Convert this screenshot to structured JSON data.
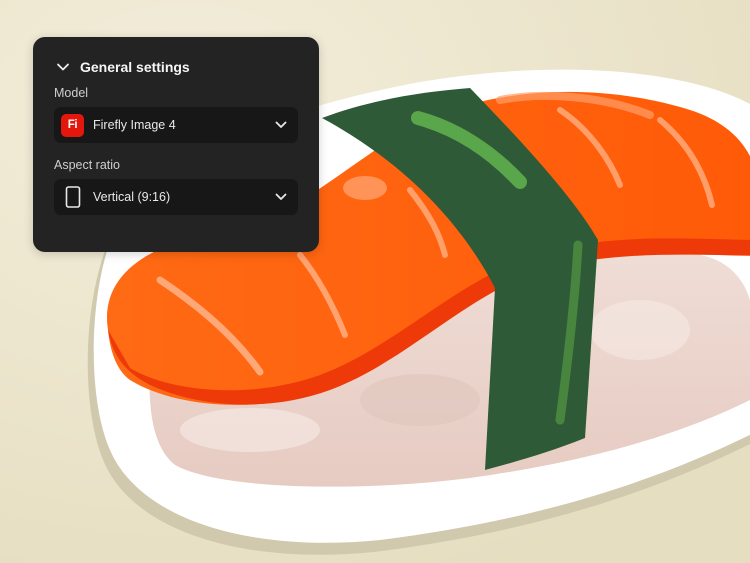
{
  "panel": {
    "title": "General settings",
    "model_label": "Model",
    "model_value": "Firefly Image 4",
    "model_icon_text": "Fi",
    "aspect_label": "Aspect ratio",
    "aspect_value": "Vertical (9:16)"
  },
  "icons": {
    "collapse": "chevron-down-icon",
    "model_dropdown": "chevron-down-icon",
    "aspect_dropdown": "chevron-down-icon",
    "model_logo": "firefly-logo-icon",
    "aspect": "portrait-rectangle-icon"
  },
  "colors": {
    "background": "#ece6cf",
    "panel": "#232323",
    "select": "#171717",
    "firefly_red": "#e4170d",
    "salmon": "#ff5a0d",
    "seaweed": "#2f5a38",
    "rice": "#efdcd5"
  }
}
